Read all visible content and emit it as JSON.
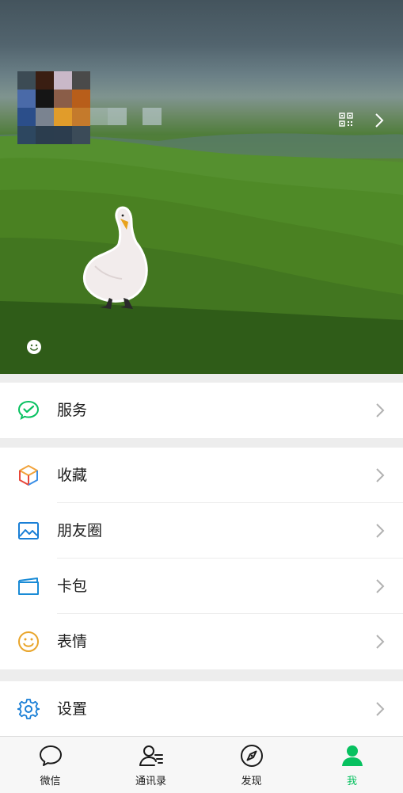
{
  "header": {
    "avatar_colors": [
      "#3c4b54",
      "#3a1e12",
      "#c9b8c8",
      "#4a4a4a",
      "#4a6aa8",
      "#151515",
      "#8a5d48",
      "#b85e1a",
      "#2b4e8a",
      "#7a8390",
      "#e19c2a",
      "#c47a2c",
      "#2d4760",
      "#2b3d4e",
      "#2c3d4e",
      "#3b4b58"
    ],
    "qr_icon": "qr-code-icon",
    "chevron_icon": "chevron-right-icon",
    "status_icon": "smiley-status-icon"
  },
  "menu": {
    "services": {
      "label": "服务",
      "icon": "wechat-pay-icon",
      "color": "#07c160"
    },
    "favorites": {
      "label": "收藏",
      "icon": "cube-icon"
    },
    "moments": {
      "label": "朋友圈",
      "icon": "image-icon",
      "color": "#1a7fd6"
    },
    "cards": {
      "label": "卡包",
      "icon": "card-icon",
      "color": "#1a8bd6"
    },
    "stickers": {
      "label": "表情",
      "icon": "smiley-icon",
      "color": "#e9a52b"
    },
    "settings": {
      "label": "设置",
      "icon": "gear-icon",
      "color": "#1a7fd6"
    }
  },
  "tabs": [
    {
      "label": "微信",
      "icon": "chat-bubble-icon"
    },
    {
      "label": "通讯录",
      "icon": "contacts-icon"
    },
    {
      "label": "发现",
      "icon": "compass-icon"
    },
    {
      "label": "我",
      "icon": "person-icon",
      "active": true
    }
  ],
  "colors": {
    "accent": "#07c160",
    "background": "#ededed"
  }
}
